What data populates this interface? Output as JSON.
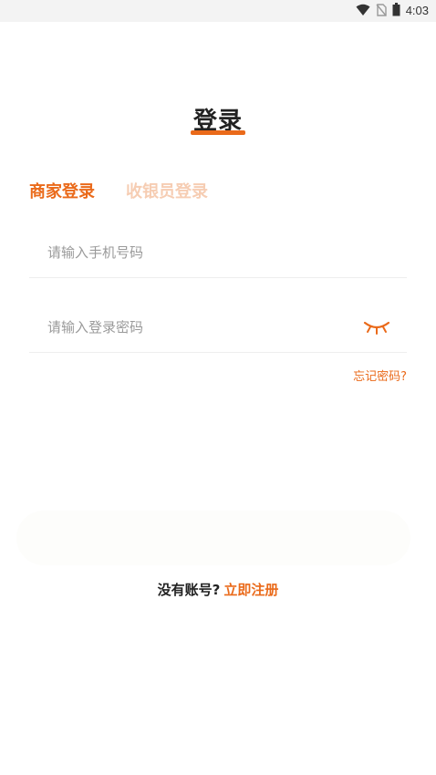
{
  "status_bar": {
    "time": "4:03",
    "icons": [
      "wifi-icon",
      "no-sim-icon",
      "battery-icon"
    ]
  },
  "page": {
    "title": "登录"
  },
  "tabs": [
    {
      "label": "商家登录",
      "active": true
    },
    {
      "label": "收银员登录",
      "active": false
    }
  ],
  "form": {
    "phone": {
      "placeholder": "请输入手机号码",
      "value": ""
    },
    "password": {
      "placeholder": "请输入登录密码",
      "value": ""
    },
    "password_toggle_icon": "eye-closed-icon",
    "forgot_password": "忘记密码?"
  },
  "register": {
    "prompt": "没有账号?",
    "link": "立即注册"
  },
  "colors": {
    "accent": "#ea6a1a",
    "accent_light": "#f6cdb3",
    "text": "#222222",
    "placeholder": "#9a9a9a"
  }
}
